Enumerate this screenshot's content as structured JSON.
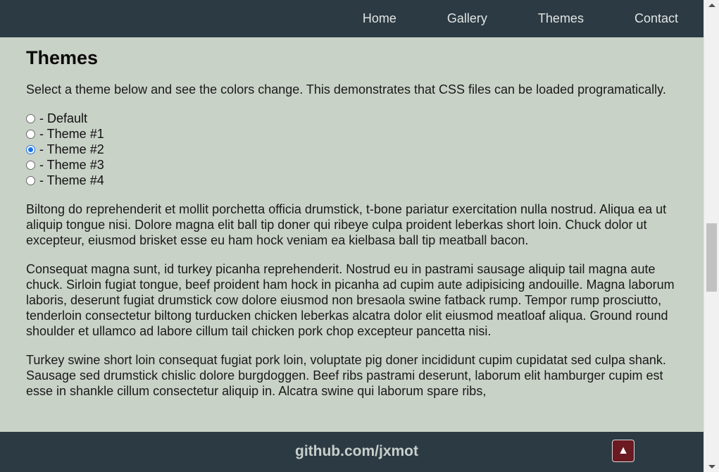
{
  "nav": {
    "items": [
      {
        "label": "Home"
      },
      {
        "label": "Gallery"
      },
      {
        "label": "Themes"
      },
      {
        "label": "Contact"
      }
    ]
  },
  "page": {
    "title": "Themes",
    "intro": "Select a theme below and see the colors change. This demonstrates that CSS files can be loaded programatically."
  },
  "themes": {
    "options": [
      {
        "label": "- Default",
        "checked": false
      },
      {
        "label": "- Theme #1",
        "checked": false
      },
      {
        "label": "- Theme #2",
        "checked": true
      },
      {
        "label": "- Theme #3",
        "checked": false
      },
      {
        "label": "- Theme #4",
        "checked": false
      }
    ]
  },
  "paragraphs": [
    "Biltong do reprehenderit et mollit porchetta officia drumstick, t-bone pariatur exercitation nulla nostrud. Aliqua ea ut aliquip tongue nisi. Dolore magna elit ball tip doner qui ribeye culpa proident leberkas short loin. Chuck dolor ut excepteur, eiusmod brisket esse eu ham hock veniam ea kielbasa ball tip meatball bacon.",
    "Consequat magna sunt, id turkey picanha reprehenderit. Nostrud eu in pastrami sausage aliquip tail magna aute chuck. Sirloin fugiat tongue, beef proident ham hock in picanha ad cupim aute adipisicing andouille. Magna laborum laboris, deserunt fugiat drumstick cow dolore eiusmod non bresaola swine fatback rump. Tempor rump prosciutto, tenderloin consectetur biltong turducken chicken leberkas alcatra dolor elit eiusmod meatloaf aliqua. Ground round shoulder et ullamco ad labore cillum tail chicken pork chop excepteur pancetta nisi.",
    "Turkey swine short loin consequat fugiat pork loin, voluptate pig doner incididunt cupim cupidatat sed culpa shank. Sausage sed drumstick chislic dolore burgdoggen. Beef ribs pastrami deserunt, laborum elit hamburger cupim est esse in shankle cillum consectetur aliquip in. Alcatra swine qui laborum spare ribs,"
  ],
  "footer": {
    "link": "github.com/jxmot",
    "top_button_icon": "▲"
  },
  "colors": {
    "nav_bg": "#2c3a43",
    "page_bg": "#c9d2c7",
    "top_button_bg": "#6b1a22",
    "radio_accent": "#1a73e8"
  },
  "icons": {
    "top_button": "arrow-up-icon"
  }
}
